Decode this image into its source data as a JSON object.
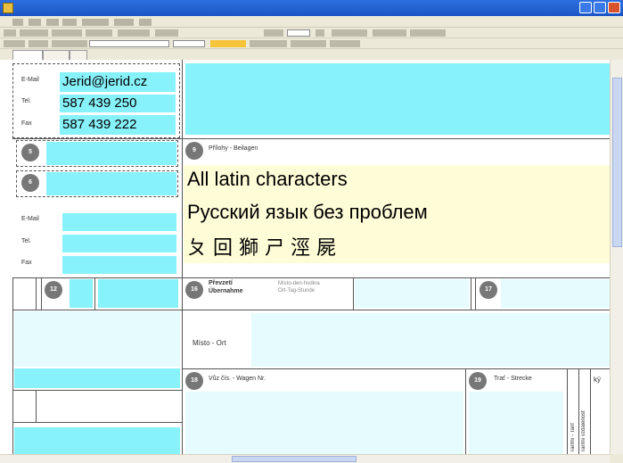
{
  "window": {
    "title": "",
    "icon": "document-icon"
  },
  "tabs": [
    {
      "label": ""
    },
    {
      "label": ""
    },
    {
      "label": ""
    }
  ],
  "form": {
    "contact_top": {
      "email_label": "E-Mail",
      "email_value": "Jerid@jerid.cz",
      "tel_label": "Tel.",
      "tel_value": "587 439 250",
      "fax_label": "Fax",
      "fax_value": "587 439 222"
    },
    "badges": {
      "b5": "5",
      "b6": "6",
      "b9": "9",
      "b12": "12",
      "b16": "16",
      "b17": "17",
      "b18": "18",
      "b19": "19"
    },
    "contact_bottom": {
      "email_label": "E-Mail",
      "tel_label": "Tel.",
      "fax_label": "Fax"
    },
    "attachments_label": "Přílohy - Beilagen",
    "text_lines": {
      "latin": "All latin characters",
      "cyrillic": "Русский язык без проблем",
      "cjk": "ㄆ 回 獅 ㄕ 涇 屍"
    },
    "takeover": {
      "label_cz": "Převzetí",
      "label_de": "Übernahme",
      "hint_1": "Místo-den-hodina",
      "hint_2": "Ort-Tag-Stunde"
    },
    "place_label": "Místo - Ort",
    "wagon_label": "Vůz čís. - Wagen Nr.",
    "route_label": "Trať - Strecke",
    "vertical_label": "Tarifní - Tarif",
    "vertical_label_2": "Tarifní vzdálenost",
    "edge_label": "kÿ"
  },
  "colors": {
    "field_cyan": "#87f2fa",
    "field_light": "#e6fbfd",
    "text_area_yellow": "#fffdd8",
    "titlebar": "#1c55c4"
  }
}
